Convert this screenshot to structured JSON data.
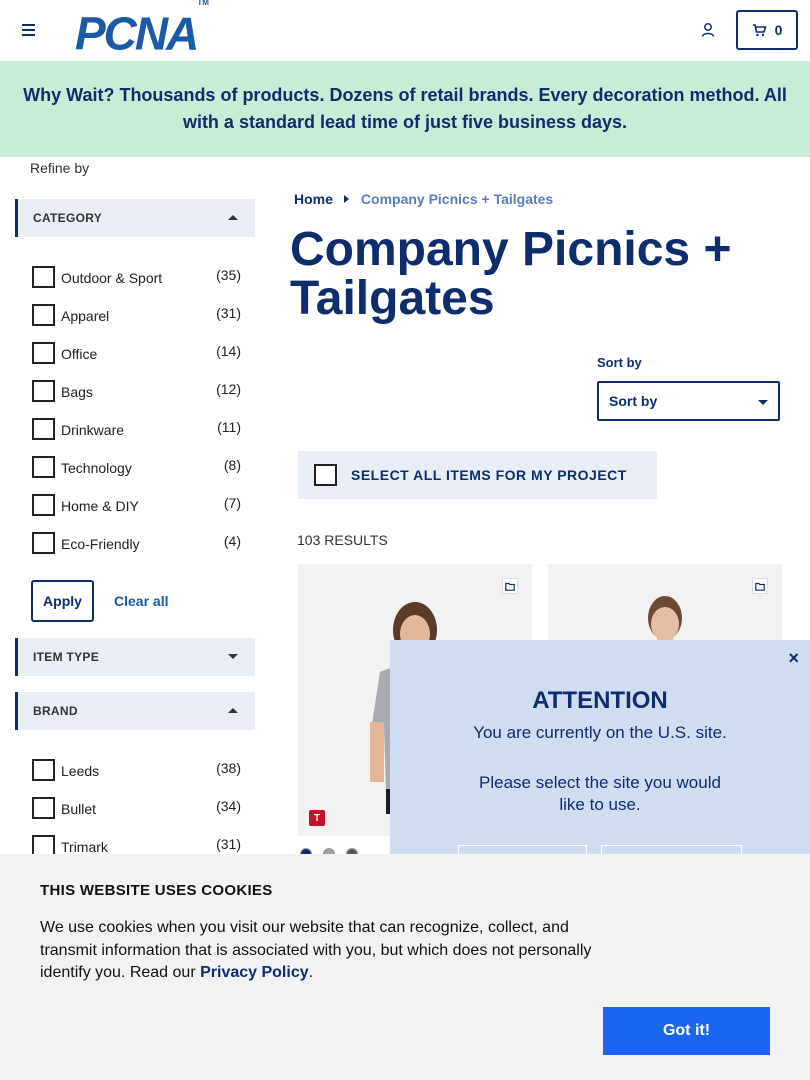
{
  "header": {
    "logo_text": "PCNA",
    "logo_tm": "TM",
    "cart_count": "0"
  },
  "banner": {
    "text": "Why Wait? Thousands of products. Dozens of retail brands. Every decoration method. All with a standard lead time of just five business days."
  },
  "sidebar": {
    "refine_label": "Refine by",
    "category_title": "CATEGORY",
    "category_items": [
      {
        "label": "Outdoor & Sport",
        "count": "(35)"
      },
      {
        "label": "Apparel",
        "count": "(31)"
      },
      {
        "label": "Office",
        "count": "(14)"
      },
      {
        "label": "Bags",
        "count": "(12)"
      },
      {
        "label": "Drinkware",
        "count": "(11)"
      },
      {
        "label": "Technology",
        "count": "(8)"
      },
      {
        "label": "Home & DIY",
        "count": "(7)"
      },
      {
        "label": "Eco-Friendly",
        "count": "(4)"
      }
    ],
    "apply_label": "Apply",
    "clear_label": "Clear all",
    "item_type_title": "ITEM TYPE",
    "brand_title": "BRAND",
    "brand_items": [
      {
        "label": "Leeds",
        "count": "(38)"
      },
      {
        "label": "Bullet",
        "count": "(34)"
      },
      {
        "label": "Trimark",
        "count": "(31)"
      }
    ]
  },
  "main": {
    "breadcrumb_home": "Home",
    "breadcrumb_current": "Company Picnics + Tailgates",
    "title": "Company Picnics + Tailgates",
    "sort_label": "Sort by",
    "sort_value": "Sort by",
    "select_all_label": "SELECT ALL ITEMS FOR MY PROJECT",
    "results_count": "103 RESULTS",
    "brand_badge": "T",
    "swatch_colors": [
      "#0d2d6c",
      "#9aa0a6",
      "#555a5e"
    ]
  },
  "attention": {
    "title": "ATTENTION",
    "line1": "You are currently on the U.S. site.",
    "line2": "Please select the site you would like to use.",
    "close": "×"
  },
  "cookie": {
    "title": "THIS WEBSITE USES COOKIES",
    "text": "We use cookies when you visit our website that can recognize, collect, and transmit information that is associated with you, but which does not personally identify you. Read our ",
    "link": "Privacy Policy",
    "suffix": ".",
    "button": "Got it!"
  }
}
